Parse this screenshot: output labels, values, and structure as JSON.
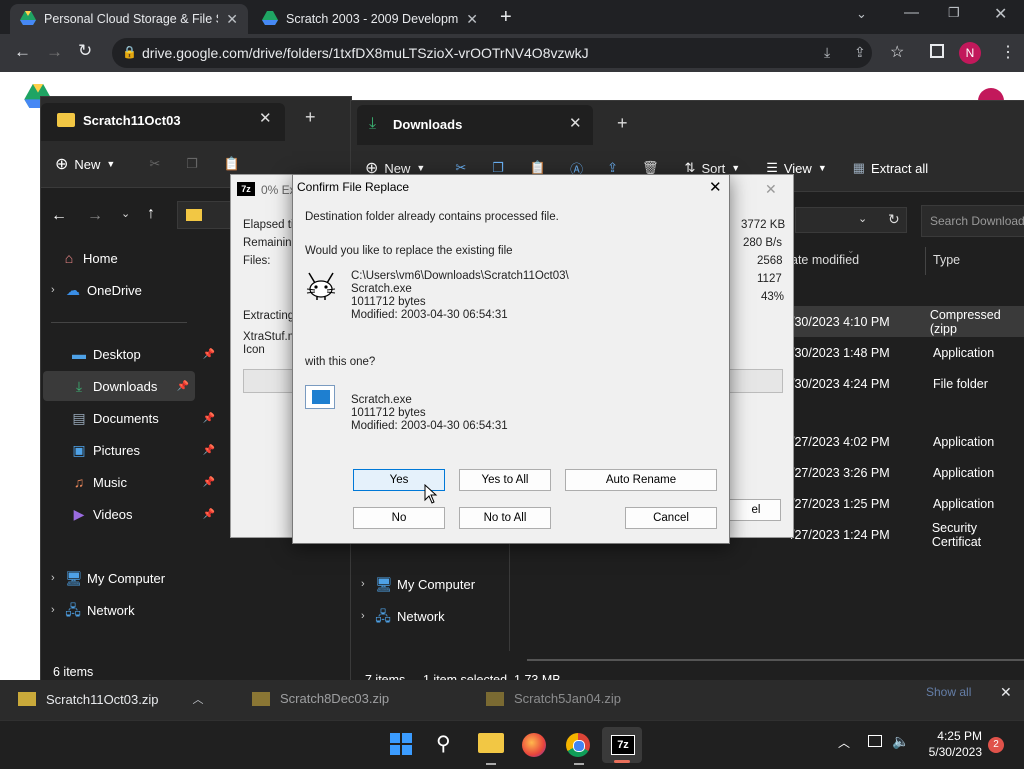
{
  "browser": {
    "tabs": [
      {
        "title": "Personal Cloud Storage & File Sh",
        "active": true
      },
      {
        "title": "Scratch 2003 - 2009 Developmen",
        "active": false
      }
    ],
    "url": "drive.google.com/drive/folders/1txfDX8muLTSzioX-vrOOTrNV4O8vzwkJ",
    "profile_initial": "N"
  },
  "explorer_left": {
    "tab_title": "Scratch11Oct03",
    "new_label": "New",
    "nav_items": [
      {
        "label": "Home"
      },
      {
        "label": "OneDrive"
      },
      {
        "label": "Desktop"
      },
      {
        "label": "Downloads"
      },
      {
        "label": "Documents"
      },
      {
        "label": "Pictures"
      },
      {
        "label": "Music"
      },
      {
        "label": "Videos"
      },
      {
        "label": "My Computer"
      },
      {
        "label": "Network"
      }
    ],
    "status": "6 items"
  },
  "explorer_right": {
    "tab_title": "Downloads",
    "new_label": "New",
    "sort_label": "Sort",
    "view_label": "View",
    "extract_label": "Extract all",
    "search_placeholder": "Search Downloads",
    "col_date": "ate modified",
    "col_type": "Type",
    "rows": [
      {
        "date": "/30/2023 4:10 PM",
        "type": "Compressed (zipp"
      },
      {
        "date": "/30/2023 1:48 PM",
        "type": "Application"
      },
      {
        "date": "/30/2023 4:24 PM",
        "type": "File folder"
      },
      {
        "date": "/27/2023 4:02 PM",
        "type": "Application"
      },
      {
        "date": "/27/2023 3:26 PM",
        "type": "Application"
      },
      {
        "date": "/27/2023 1:25 PM",
        "type": "Application"
      },
      {
        "date": "/27/2023 1:24 PM",
        "type": "Security Certificat"
      }
    ],
    "nav_items": [
      {
        "label": "My Computer"
      },
      {
        "label": "Network"
      }
    ],
    "status": "7 items",
    "status_selected": "1 item selected  1.73 MB"
  },
  "sevenzip": {
    "title": "0% Ex",
    "elapsed": "Elapsed tin",
    "remaining": "Remaining",
    "files": "Files:",
    "size": "3772 KB",
    "speed": "280 B/s",
    "files_count": "2568",
    "n1127": "1127",
    "percent": "43%",
    "extracting": "Extracting",
    "file1": "XtraStuf.ma",
    "file2": "Icon",
    "cancel_partial": "el"
  },
  "confirm": {
    "title": "Confirm File Replace",
    "line1": "Destination folder already contains processed file.",
    "line2": "Would you like to replace the existing file",
    "existing_path": "C:\\Users\\vm6\\Downloads\\Scratch11Oct03\\",
    "existing_name": "Scratch.exe",
    "existing_size": "1011712 bytes",
    "existing_modified": "Modified: 2003-04-30 06:54:31",
    "with_this": "with this one?",
    "new_name": "Scratch.exe",
    "new_size": "1011712 bytes",
    "new_modified": "Modified: 2003-04-30 06:54:31",
    "buttons": {
      "yes": "Yes",
      "yes_all": "Yes to All",
      "auto_rename": "Auto Rename",
      "no": "No",
      "no_all": "No to All",
      "cancel": "Cancel"
    }
  },
  "downloads_bar": {
    "items": [
      "Scratch11Oct03.zip",
      "Scratch8Dec03.zip",
      "Scratch5Jan04.zip"
    ],
    "show_all": "Show all"
  },
  "taskbar": {
    "time": "4:25 PM",
    "date": "5/30/2023",
    "badge": "2"
  }
}
